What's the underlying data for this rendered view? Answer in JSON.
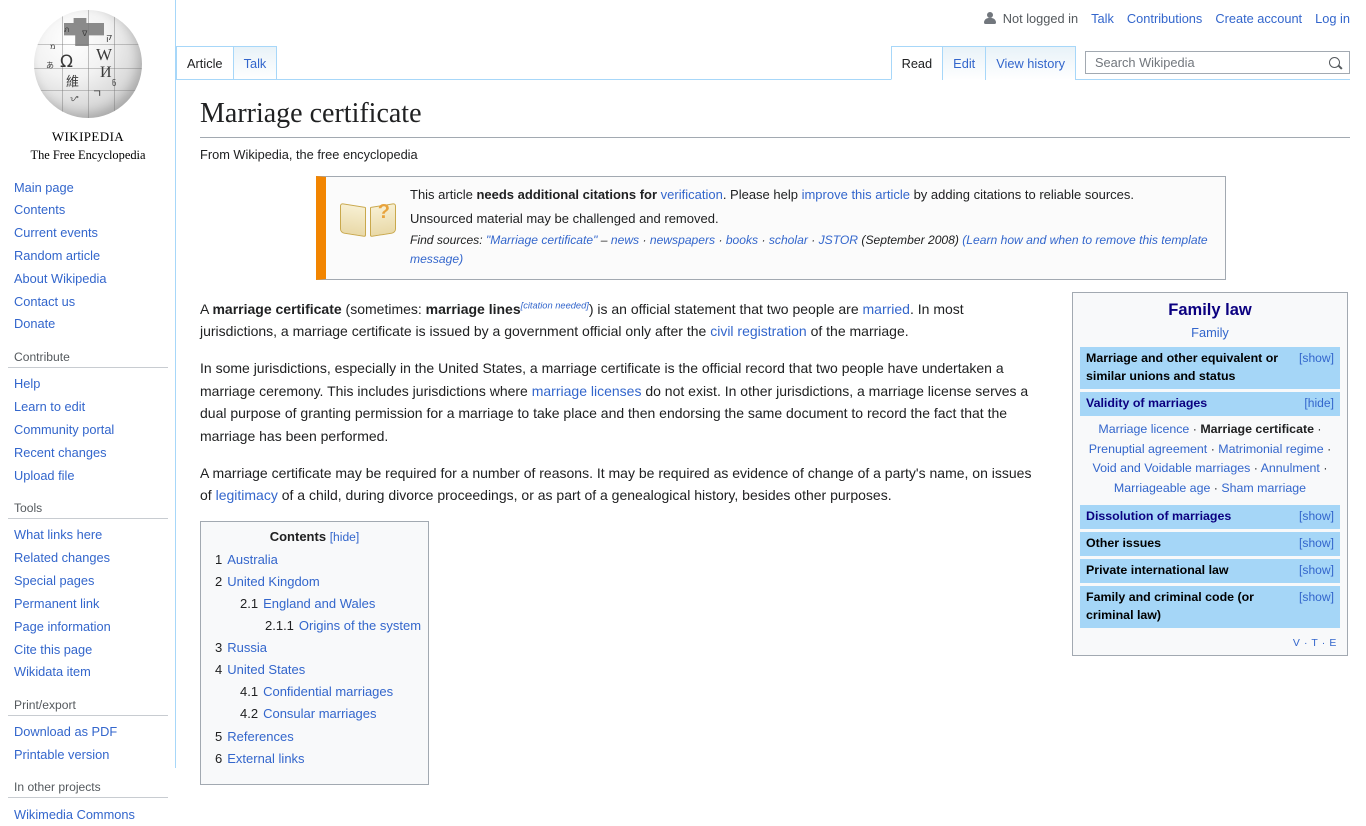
{
  "personal_bar": {
    "user_icon": "user-icon",
    "status": "Not logged in",
    "links": [
      "Talk",
      "Contributions",
      "Create account",
      "Log in"
    ]
  },
  "sidebar": {
    "logo": {
      "wordmark": "Wikipedia",
      "tagline": "The Free Encyclopedia",
      "globe_icon": "wikipedia-globe-logo"
    },
    "portlets": [
      {
        "heading": "",
        "items": [
          "Main page",
          "Contents",
          "Current events",
          "Random article",
          "About Wikipedia",
          "Contact us",
          "Donate"
        ]
      },
      {
        "heading": "Contribute",
        "items": [
          "Help",
          "Learn to edit",
          "Community portal",
          "Recent changes",
          "Upload file"
        ]
      },
      {
        "heading": "Tools",
        "items": [
          "What links here",
          "Related changes",
          "Special pages",
          "Permanent link",
          "Page information",
          "Cite this page",
          "Wikidata item"
        ]
      },
      {
        "heading": "Print/export",
        "items": [
          "Download as PDF",
          "Printable version"
        ]
      },
      {
        "heading": "In other projects",
        "items": [
          "Wikimedia Commons"
        ]
      }
    ]
  },
  "namespace_tabs": [
    {
      "label": "Article",
      "selected": true
    },
    {
      "label": "Talk",
      "selected": false
    }
  ],
  "view_tabs": [
    {
      "label": "Read",
      "selected": true
    },
    {
      "label": "Edit",
      "selected": false
    },
    {
      "label": "View history",
      "selected": false
    }
  ],
  "search": {
    "placeholder": "Search Wikipedia",
    "value": "",
    "icon": "search-icon"
  },
  "article": {
    "title": "Marriage certificate",
    "site_sub": "From Wikipedia, the free encyclopedia"
  },
  "ambox": {
    "icon": "open-book-question-mark-icon",
    "accent_color": "#f28500",
    "line1_a": "This article ",
    "line1_b": "needs additional citations for ",
    "line1_link1": "verification",
    "line1_c": ". Please help ",
    "line1_link2": "improve this article",
    "line1_d": " by adding citations to reliable sources.",
    "line2": "Unsourced material may be challenged and removed.",
    "find_sources_label": "Find sources:",
    "find_sources_query": "\"Marriage certificate\"",
    "dash": "–",
    "source_links": [
      "news",
      "newspapers",
      "books",
      "scholar",
      "JSTOR"
    ],
    "date": "(September 2008)",
    "learn_more": "(Learn how and when to remove this template message)"
  },
  "paragraphs": {
    "p1": {
      "t1": "A ",
      "b1": "marriage certificate",
      "t2": " (sometimes: ",
      "b2": "marriage lines",
      "cn": "[citation needed]",
      "t3": ") is an official statement that two people are ",
      "l1": "married",
      "t4": ". In most jurisdictions, a marriage certificate is issued by a government official only after the ",
      "l2": "civil registration",
      "t5": " of the marriage."
    },
    "p2": {
      "t1": "In some jurisdictions, especially in the United States, a marriage certificate is the official record that two people have undertaken a marriage ceremony. This includes jurisdictions where ",
      "l1": "marriage licenses",
      "t2": " do not exist. In other jurisdictions, a marriage license serves a dual purpose of granting permission for a marriage to take place and then endorsing the same document to record the fact that the marriage has been performed."
    },
    "p3": {
      "t1": "A marriage certificate may be required for a number of reasons. It may be required as evidence of change of a party's name, on issues of ",
      "l1": "legitimacy",
      "t2": " of a child, during divorce proceedings, or as part of a genealogical history, besides other purposes."
    }
  },
  "toc": {
    "title": "Contents",
    "toggle": "[hide]",
    "entries": [
      {
        "num": "1",
        "label": "Australia",
        "level": 1
      },
      {
        "num": "2",
        "label": "United Kingdom",
        "level": 1
      },
      {
        "num": "2.1",
        "label": "England and Wales",
        "level": 2
      },
      {
        "num": "2.1.1",
        "label": "Origins of the system",
        "level": 3
      },
      {
        "num": "3",
        "label": "Russia",
        "level": 1
      },
      {
        "num": "4",
        "label": "United States",
        "level": 1
      },
      {
        "num": "4.1",
        "label": "Confidential marriages",
        "level": 2
      },
      {
        "num": "4.2",
        "label": "Consular marriages",
        "level": 2
      },
      {
        "num": "5",
        "label": "References",
        "level": 1
      },
      {
        "num": "6",
        "label": "External links",
        "level": 1
      }
    ]
  },
  "infobox": {
    "title": "Family law",
    "subtitle": "Family",
    "header_bg": "#a5d6f7",
    "groups": [
      {
        "label": "Marriage and other equivalent or similar unions and status",
        "label_is_link": false,
        "toggle": "[show]",
        "expanded": false,
        "items": []
      },
      {
        "label": "Validity of marriages",
        "label_is_link": true,
        "toggle": "[hide]",
        "expanded": true,
        "items": [
          "Marriage licence",
          "Marriage certificate",
          "Prenuptial agreement",
          "Matrimonial regime",
          "Void and Voidable marriages",
          "Annulment",
          "Marriageable age",
          "Sham marriage"
        ],
        "bold_item": "Marriage certificate"
      },
      {
        "label": "Dissolution of marriages",
        "label_is_link": true,
        "toggle": "[show]",
        "expanded": false,
        "items": []
      },
      {
        "label": "Other issues",
        "label_is_link": false,
        "toggle": "[show]",
        "expanded": false,
        "items": []
      },
      {
        "label": "Private international law",
        "label_is_link": false,
        "toggle": "[show]",
        "expanded": false,
        "items": []
      },
      {
        "label": "Family and criminal code (or criminal law)",
        "label_is_link": false,
        "toggle": "[show]",
        "expanded": false,
        "items": []
      }
    ],
    "vte": "V · T · E"
  }
}
